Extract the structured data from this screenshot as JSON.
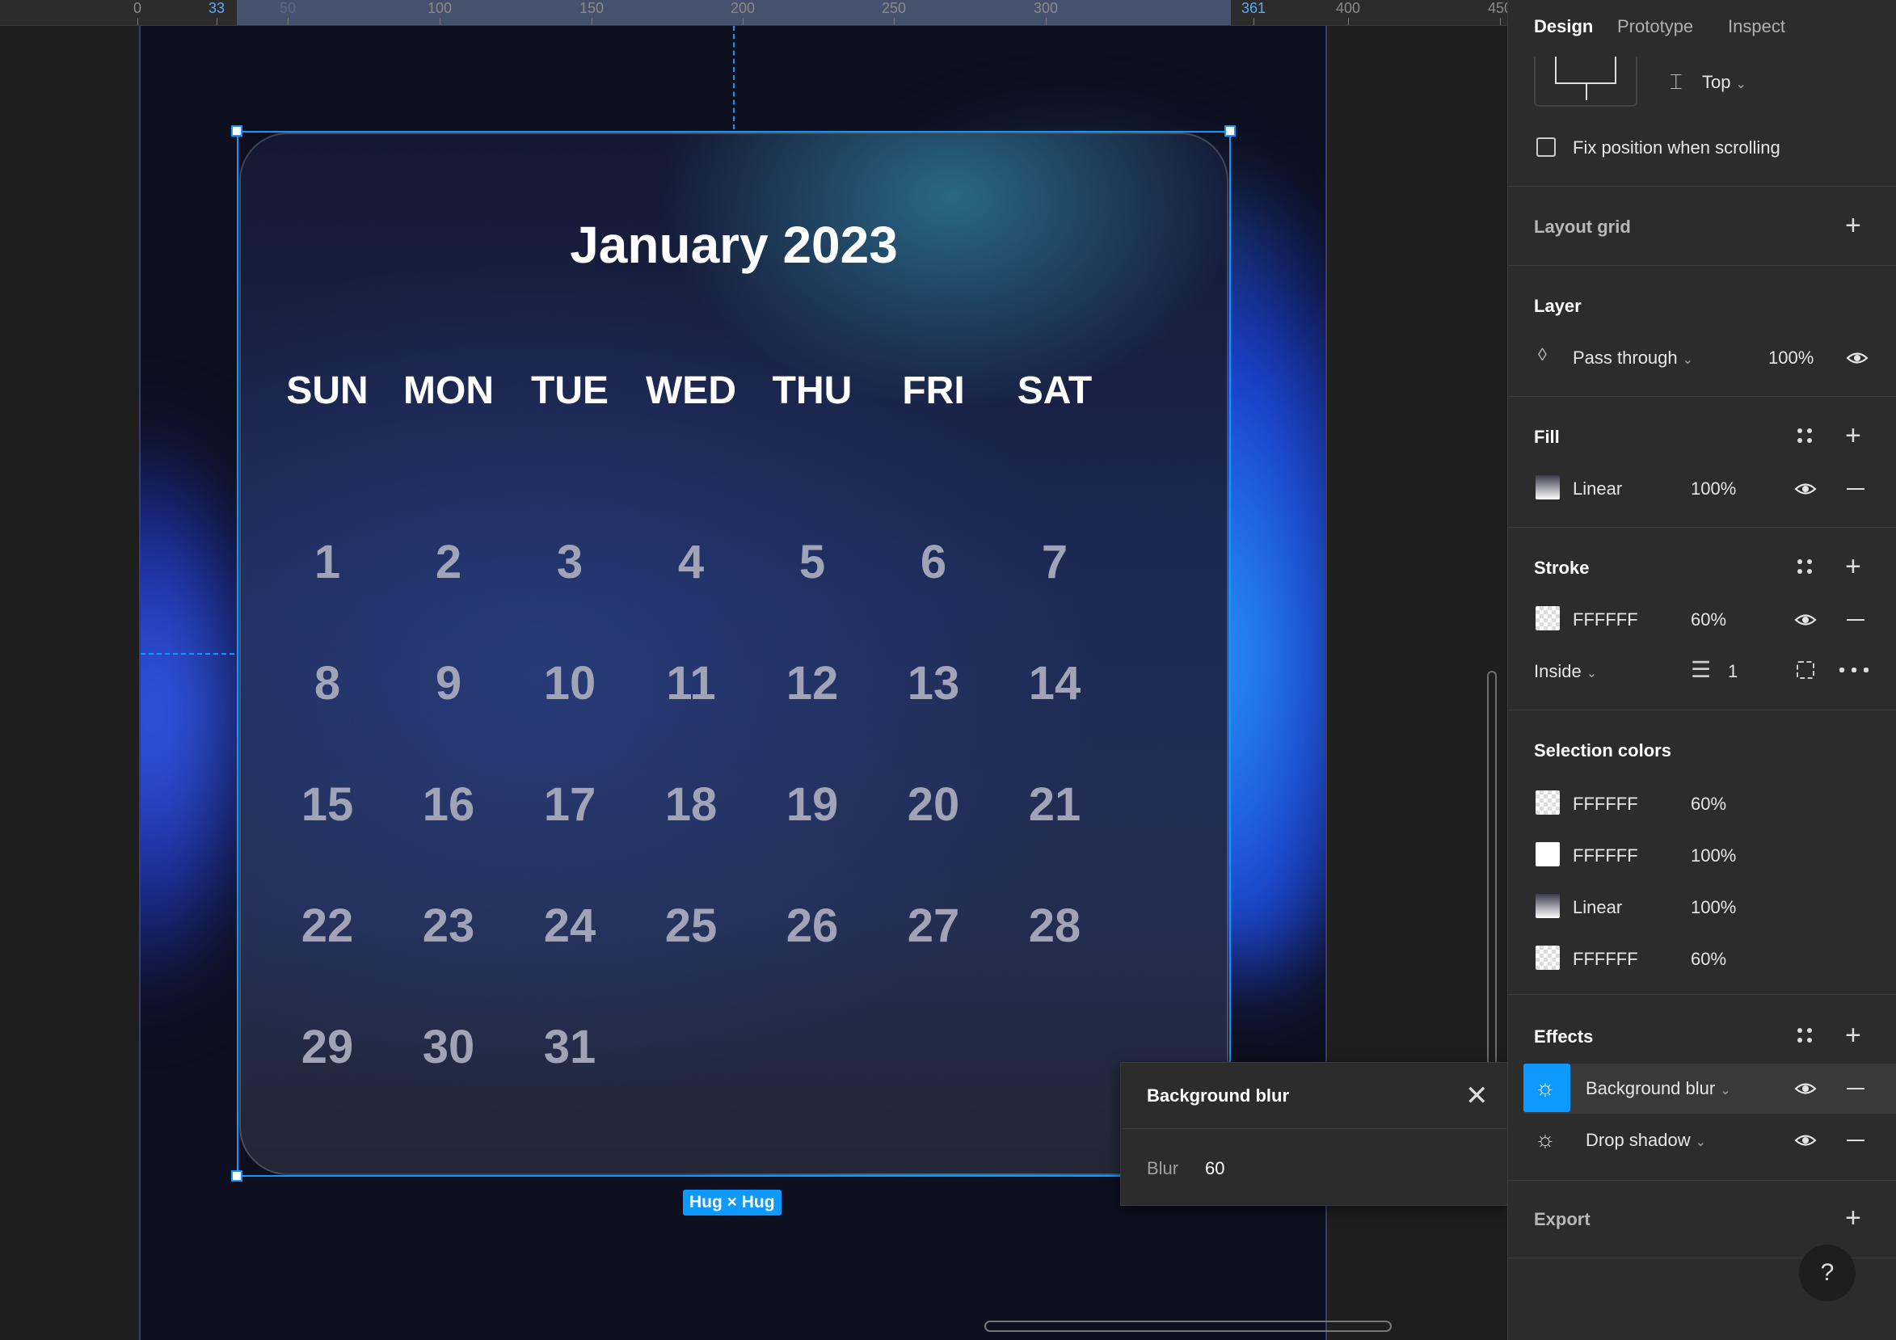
{
  "ruler": {
    "ticks": [
      {
        "label": "0"
      },
      {
        "label": "33"
      },
      {
        "label": "50"
      },
      {
        "label": "100"
      },
      {
        "label": "150"
      },
      {
        "label": "200"
      },
      {
        "label": "250"
      },
      {
        "label": "300"
      },
      {
        "label": "361"
      },
      {
        "label": "400"
      },
      {
        "label": "450"
      }
    ]
  },
  "calendar": {
    "title": "January 2023",
    "weekdays": [
      "SUN",
      "MON",
      "TUE",
      "WED",
      "THU",
      "FRI",
      "SAT"
    ],
    "weeks": [
      [
        "1",
        "2",
        "3",
        "4",
        "5",
        "6",
        "7"
      ],
      [
        "8",
        "9",
        "10",
        "11",
        "12",
        "13",
        "14"
      ],
      [
        "15",
        "16",
        "17",
        "18",
        "19",
        "20",
        "21"
      ],
      [
        "22",
        "23",
        "24",
        "25",
        "26",
        "27",
        "28"
      ],
      [
        "29",
        "30",
        "31"
      ]
    ]
  },
  "selection": {
    "size_label": "Hug × Hug"
  },
  "popup": {
    "title": "Background blur",
    "blur_label": "Blur",
    "blur_value": "60"
  },
  "tabs": {
    "design": "Design",
    "prototype": "Prototype",
    "inspect": "Inspect"
  },
  "constraints": {
    "vertical": "Top",
    "fix_position": "Fix position when scrolling"
  },
  "layout_grid": {
    "title": "Layout grid"
  },
  "layer": {
    "title": "Layer",
    "blend": "Pass through",
    "opacity": "100%"
  },
  "fill": {
    "title": "Fill",
    "type": "Linear",
    "opacity": "100%"
  },
  "stroke": {
    "title": "Stroke",
    "color": "FFFFFF",
    "opacity": "60%",
    "position": "Inside",
    "weight": "1"
  },
  "selection_colors": {
    "title": "Selection colors",
    "items": [
      {
        "name": "FFFFFF",
        "opacity": "60%",
        "swatch": "check"
      },
      {
        "name": "FFFFFF",
        "opacity": "100%",
        "swatch": "white"
      },
      {
        "name": "Linear",
        "opacity": "100%",
        "swatch": "linear"
      },
      {
        "name": "FFFFFF",
        "opacity": "60%",
        "swatch": "check"
      }
    ]
  },
  "effects": {
    "title": "Effects",
    "items": [
      {
        "name": "Background blur"
      },
      {
        "name": "Drop shadow"
      }
    ]
  },
  "export": {
    "title": "Export"
  },
  "help": {
    "label": "?"
  },
  "colors": {
    "accent": "#0d99ff",
    "panel": "#2c2c2c"
  }
}
